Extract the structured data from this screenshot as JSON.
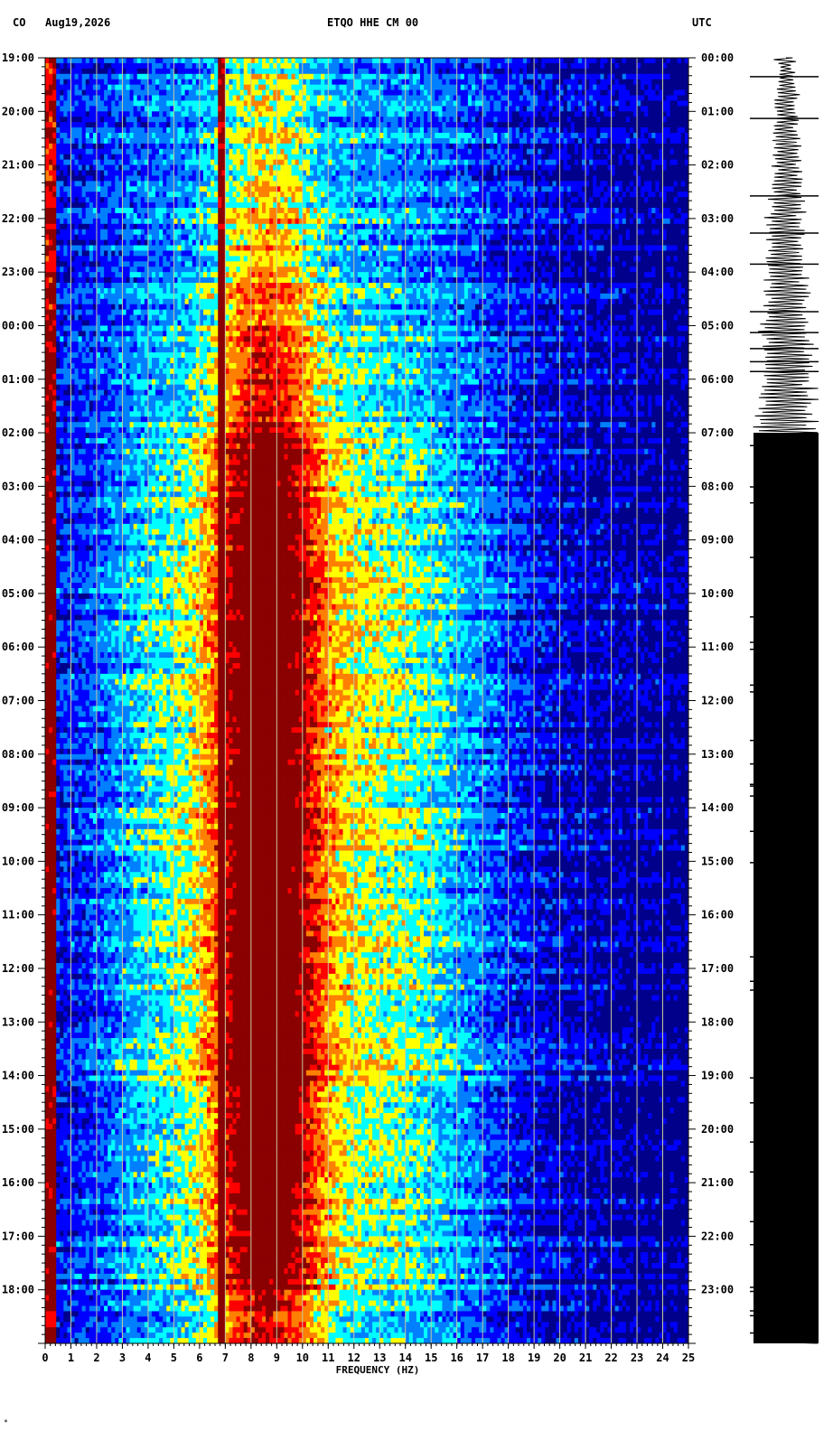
{
  "header": {
    "network": "CO",
    "date": "Aug19,2026",
    "channel": "ETQO HHE CM 00",
    "timezone": "UTC"
  },
  "footer_mark": "*",
  "chart_data": {
    "type": "heatmap",
    "title": "ETQO HHE CM 00",
    "xlabel": "FREQUENCY (HZ)",
    "x_ticks": [
      "0",
      "1",
      "2",
      "3",
      "4",
      "5",
      "6",
      "7",
      "8",
      "9",
      "10",
      "11",
      "12",
      "13",
      "14",
      "15",
      "16",
      "17",
      "18",
      "19",
      "20",
      "21",
      "22",
      "23",
      "24",
      "25"
    ],
    "xlim": [
      0,
      25
    ],
    "y_ticks_left": [
      "19:00",
      "20:00",
      "21:00",
      "22:00",
      "23:00",
      "00:00",
      "01:00",
      "02:00",
      "03:00",
      "04:00",
      "05:00",
      "06:00",
      "07:00",
      "08:00",
      "09:00",
      "10:00",
      "11:00",
      "12:00",
      "13:00",
      "14:00",
      "15:00",
      "16:00",
      "17:00",
      "18:00"
    ],
    "y_ticks_right": [
      "00:00",
      "01:00",
      "02:00",
      "03:00",
      "04:00",
      "05:00",
      "06:00",
      "07:00",
      "08:00",
      "09:00",
      "10:00",
      "11:00",
      "12:00",
      "13:00",
      "14:00",
      "15:00",
      "16:00",
      "17:00",
      "18:00",
      "19:00",
      "20:00",
      "21:00",
      "22:00",
      "23:00"
    ],
    "ylim_hours": [
      0,
      24
    ],
    "grid": true,
    "colormap": [
      "#00008b",
      "#0000ff",
      "#0080ff",
      "#00ffff",
      "#ffff00",
      "#ff8000",
      "#ff0000",
      "#8b0000"
    ],
    "vertical_grid_color": "#c8c8a0",
    "band_strength_by_hour": [
      0.35,
      0.38,
      0.42,
      0.48,
      0.55,
      0.62,
      0.68,
      0.85,
      0.9,
      0.92,
      0.95,
      0.93,
      0.95,
      0.97,
      0.98,
      0.97,
      1.0,
      1.0,
      0.98,
      0.97,
      0.95,
      0.9,
      0.85,
      0.7
    ],
    "trace": {
      "color": "#000000",
      "saturated_from_hour": 7
    }
  }
}
